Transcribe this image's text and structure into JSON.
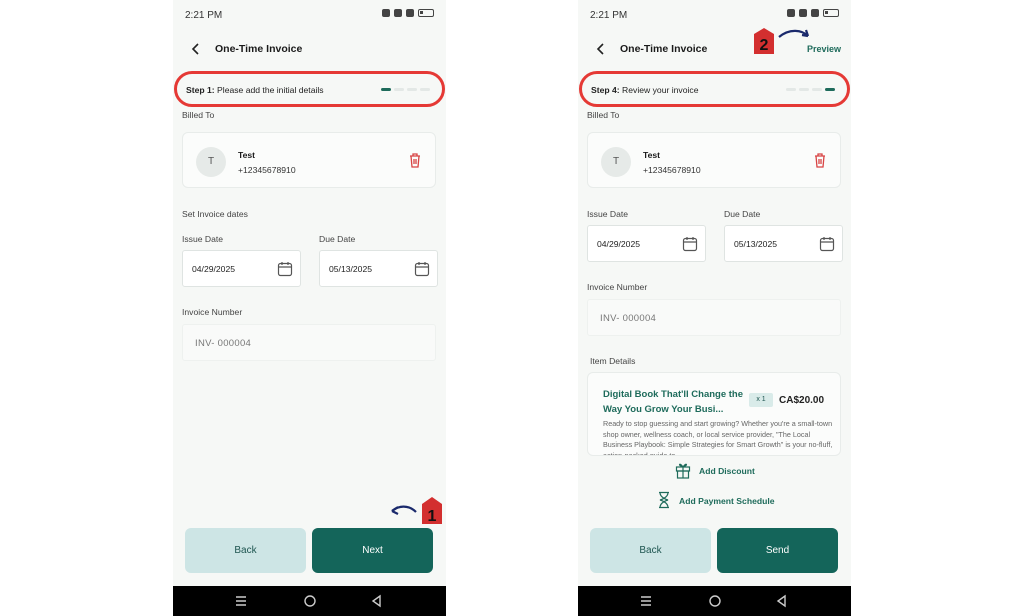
{
  "left_screen": {
    "status_time": "2:21 PM",
    "title": "One-Time Invoice",
    "step_prefix": "Step 1:",
    "step_text": "Please add the initial details",
    "billed_to_label": "Billed To",
    "client": {
      "initial": "T",
      "name": "Test",
      "phone": "+12345678910"
    },
    "dates_section_label": "Set Invoice dates",
    "issue_date_label": "Issue Date",
    "issue_date_value": "04/29/2025",
    "due_date_label": "Due Date",
    "due_date_value": "05/13/2025",
    "invoice_number_label": "Invoice Number",
    "invoice_number_value": "INV-  000004",
    "back_button": "Back",
    "primary_button": "Next",
    "marker_number": "1"
  },
  "right_screen": {
    "status_time": "2:21 PM",
    "title": "One-Time Invoice",
    "preview_link": "Preview",
    "step_prefix": "Step 4:",
    "step_text": "Review your invoice",
    "billed_to_label": "Billed To",
    "client": {
      "initial": "T",
      "name": "Test",
      "phone": "+12345678910"
    },
    "issue_date_label": "Issue Date",
    "issue_date_value": "04/29/2025",
    "due_date_label": "Due Date",
    "due_date_value": "05/13/2025",
    "invoice_number_label": "Invoice Number",
    "invoice_number_value": "INV-  000004",
    "item_details_label": "Item Details",
    "item": {
      "title": "Digital Book That'll Change the Way You Grow Your Busi...",
      "qty": "x 1",
      "price": "CA$20.00",
      "description": "Ready to stop guessing and start growing? Whether you're a small-town shop owner, wellness coach, or local service provider, \"The Local Business Playbook: Simple Strategies for Smart Growth\" is your no-fluff, action-packed guide to"
    },
    "add_discount": "Add Discount",
    "add_payment_schedule": "Add Payment Schedule",
    "back_button": "Back",
    "primary_button": "Send",
    "marker_number": "2"
  },
  "colors": {
    "accent": "#14655a",
    "highlight": "#e53935",
    "marker": "#d32f2f",
    "arrow": "#1a2a6c"
  }
}
